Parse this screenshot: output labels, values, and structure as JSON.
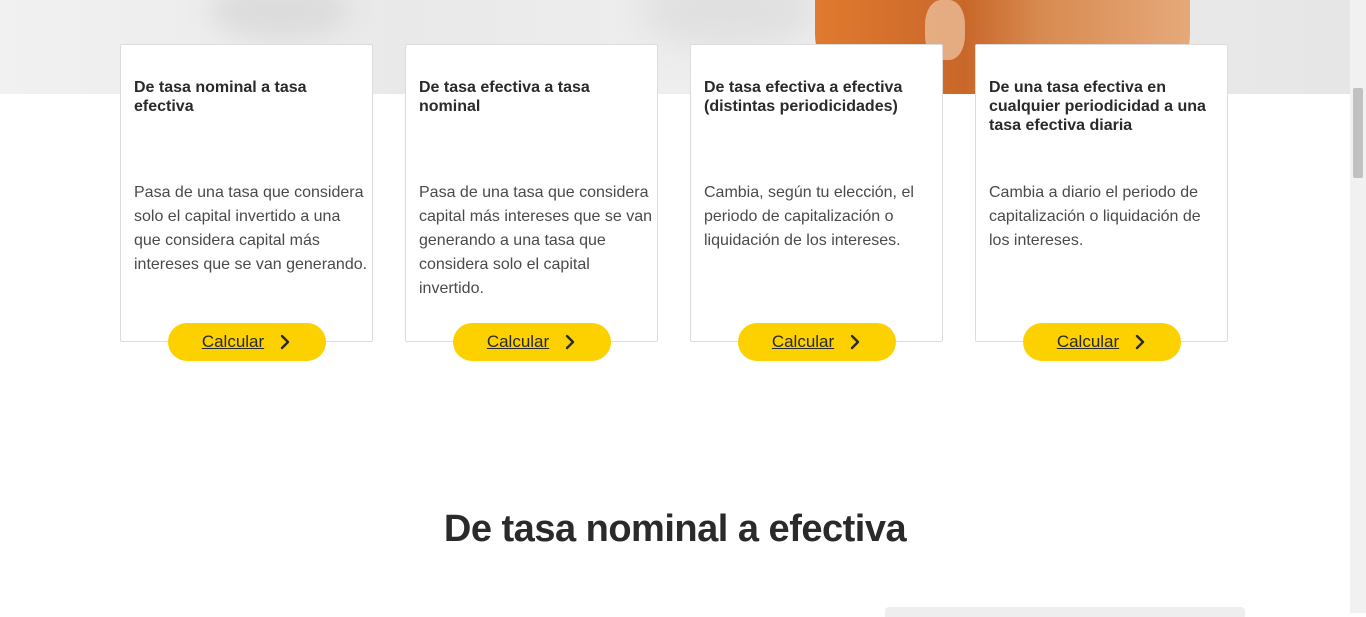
{
  "cards": [
    {
      "title": "De tasa nominal a tasa efectiva",
      "description": "Pasa de una tasa que considera solo el capital invertido a una que considera capital más intereses que se van generando.",
      "button_label": "Calcular"
    },
    {
      "title": "De tasa efectiva a tasa nominal",
      "description": "Pasa de una tasa que considera capital más intereses que se van generando a una tasa que considera solo el capital invertido.",
      "button_label": "Calcular"
    },
    {
      "title": "De tasa efectiva a efectiva (distintas periodicidades)",
      "description": "Cambia, según tu elección, el periodo de capitalización o liquidación de los intereses.",
      "button_label": "Calcular"
    },
    {
      "title": "De una tasa efectiva en cualquier periodicidad a una tasa efectiva diaria",
      "description": "Cambia a diario el periodo de capitalización o liquidación de los intereses.",
      "button_label": "Calcular"
    }
  ],
  "section": {
    "title": "De tasa nominal a efectiva"
  },
  "icons": {
    "button_icon": "chevron-right-icon"
  },
  "colors": {
    "accent": "#fdd000",
    "text": "#2a2a2a"
  }
}
